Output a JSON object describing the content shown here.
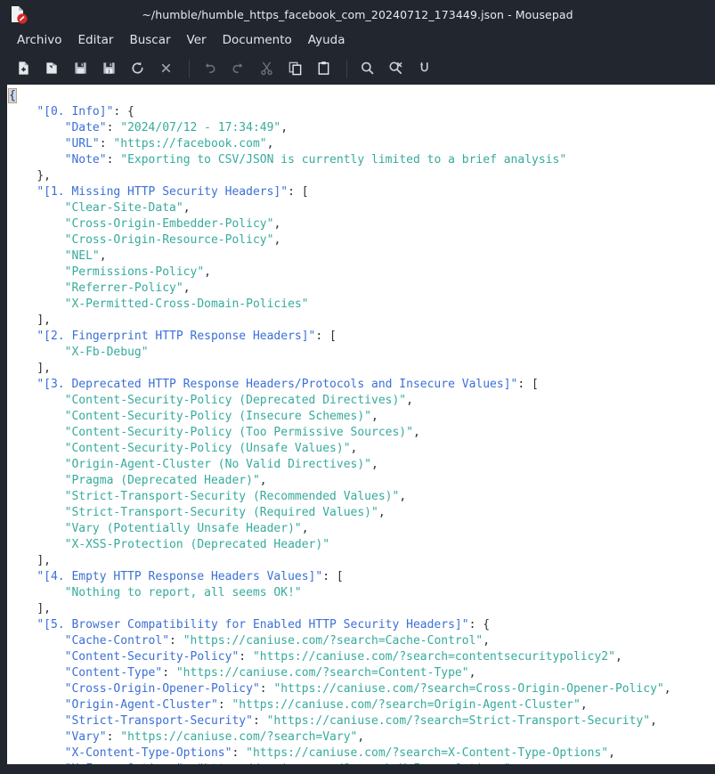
{
  "window": {
    "title": "~/humble/humble_https_facebook_com_20240712_173449.json - Mousepad",
    "icon": "document-modified-icon"
  },
  "menubar": {
    "items": [
      {
        "label": "Archivo"
      },
      {
        "label": "Editar"
      },
      {
        "label": "Buscar"
      },
      {
        "label": "Ver"
      },
      {
        "label": "Documento"
      },
      {
        "label": "Ayuda"
      }
    ]
  },
  "toolbar": {
    "groups": [
      [
        {
          "name": "new-document-icon"
        },
        {
          "name": "open-document-icon"
        },
        {
          "name": "save-icon"
        },
        {
          "name": "save-as-icon"
        },
        {
          "name": "reload-icon"
        },
        {
          "name": "close-document-icon"
        }
      ],
      [
        {
          "name": "undo-icon"
        },
        {
          "name": "redo-icon"
        },
        {
          "name": "cut-icon"
        },
        {
          "name": "copy-icon"
        },
        {
          "name": "paste-icon"
        }
      ],
      [
        {
          "name": "find-icon"
        },
        {
          "name": "find-replace-icon"
        },
        {
          "name": "go-to-line-icon"
        }
      ]
    ]
  },
  "editor": {
    "colors": {
      "key": "#3b6fd6",
      "value": "#36ab9b",
      "punctuation": "#2b3038",
      "background": "#ffffff",
      "chrome": "#22262e"
    },
    "lines": [
      {
        "indent": 0,
        "segs": [
          {
            "t": "{",
            "c": "hl"
          }
        ]
      },
      {
        "indent": 1,
        "segs": [
          {
            "t": "\"[0. Info]\"",
            "c": "k"
          },
          {
            "t": ": {",
            "c": "p"
          }
        ]
      },
      {
        "indent": 2,
        "segs": [
          {
            "t": "\"Date\"",
            "c": "k"
          },
          {
            "t": ": ",
            "c": "p"
          },
          {
            "t": "\"2024/07/12 - 17:34:49\"",
            "c": "v"
          },
          {
            "t": ",",
            "c": "p"
          }
        ]
      },
      {
        "indent": 2,
        "segs": [
          {
            "t": "\"URL\"",
            "c": "k"
          },
          {
            "t": ": ",
            "c": "p"
          },
          {
            "t": "\"https://facebook.com\"",
            "c": "v"
          },
          {
            "t": ",",
            "c": "p"
          }
        ]
      },
      {
        "indent": 2,
        "segs": [
          {
            "t": "\"Note\"",
            "c": "k"
          },
          {
            "t": ": ",
            "c": "p"
          },
          {
            "t": "\"Exporting to CSV/JSON is currently limited to a brief analysis\"",
            "c": "v"
          }
        ]
      },
      {
        "indent": 1,
        "segs": [
          {
            "t": "},",
            "c": "p"
          }
        ]
      },
      {
        "indent": 1,
        "segs": [
          {
            "t": "\"[1. Missing HTTP Security Headers]\"",
            "c": "k"
          },
          {
            "t": ": [",
            "c": "p"
          }
        ]
      },
      {
        "indent": 2,
        "segs": [
          {
            "t": "\"Clear-Site-Data\"",
            "c": "v"
          },
          {
            "t": ",",
            "c": "p"
          }
        ]
      },
      {
        "indent": 2,
        "segs": [
          {
            "t": "\"Cross-Origin-Embedder-Policy\"",
            "c": "v"
          },
          {
            "t": ",",
            "c": "p"
          }
        ]
      },
      {
        "indent": 2,
        "segs": [
          {
            "t": "\"Cross-Origin-Resource-Policy\"",
            "c": "v"
          },
          {
            "t": ",",
            "c": "p"
          }
        ]
      },
      {
        "indent": 2,
        "segs": [
          {
            "t": "\"NEL\"",
            "c": "v"
          },
          {
            "t": ",",
            "c": "p"
          }
        ]
      },
      {
        "indent": 2,
        "segs": [
          {
            "t": "\"Permissions-Policy\"",
            "c": "v"
          },
          {
            "t": ",",
            "c": "p"
          }
        ]
      },
      {
        "indent": 2,
        "segs": [
          {
            "t": "\"Referrer-Policy\"",
            "c": "v"
          },
          {
            "t": ",",
            "c": "p"
          }
        ]
      },
      {
        "indent": 2,
        "segs": [
          {
            "t": "\"X-Permitted-Cross-Domain-Policies\"",
            "c": "v"
          }
        ]
      },
      {
        "indent": 1,
        "segs": [
          {
            "t": "],",
            "c": "p"
          }
        ]
      },
      {
        "indent": 1,
        "segs": [
          {
            "t": "\"[2. Fingerprint HTTP Response Headers]\"",
            "c": "k"
          },
          {
            "t": ": [",
            "c": "p"
          }
        ]
      },
      {
        "indent": 2,
        "segs": [
          {
            "t": "\"X-Fb-Debug\"",
            "c": "v"
          }
        ]
      },
      {
        "indent": 1,
        "segs": [
          {
            "t": "],",
            "c": "p"
          }
        ]
      },
      {
        "indent": 1,
        "segs": [
          {
            "t": "\"[3. Deprecated HTTP Response Headers/Protocols and Insecure Values]\"",
            "c": "k"
          },
          {
            "t": ": [",
            "c": "p"
          }
        ]
      },
      {
        "indent": 2,
        "segs": [
          {
            "t": "\"Content-Security-Policy (Deprecated Directives)\"",
            "c": "v"
          },
          {
            "t": ",",
            "c": "p"
          }
        ]
      },
      {
        "indent": 2,
        "segs": [
          {
            "t": "\"Content-Security-Policy (Insecure Schemes)\"",
            "c": "v"
          },
          {
            "t": ",",
            "c": "p"
          }
        ]
      },
      {
        "indent": 2,
        "segs": [
          {
            "t": "\"Content-Security-Policy (Too Permissive Sources)\"",
            "c": "v"
          },
          {
            "t": ",",
            "c": "p"
          }
        ]
      },
      {
        "indent": 2,
        "segs": [
          {
            "t": "\"Content-Security-Policy (Unsafe Values)\"",
            "c": "v"
          },
          {
            "t": ",",
            "c": "p"
          }
        ]
      },
      {
        "indent": 2,
        "segs": [
          {
            "t": "\"Origin-Agent-Cluster (No Valid Directives)\"",
            "c": "v"
          },
          {
            "t": ",",
            "c": "p"
          }
        ]
      },
      {
        "indent": 2,
        "segs": [
          {
            "t": "\"Pragma (Deprecated Header)\"",
            "c": "v"
          },
          {
            "t": ",",
            "c": "p"
          }
        ]
      },
      {
        "indent": 2,
        "segs": [
          {
            "t": "\"Strict-Transport-Security (Recommended Values)\"",
            "c": "v"
          },
          {
            "t": ",",
            "c": "p"
          }
        ]
      },
      {
        "indent": 2,
        "segs": [
          {
            "t": "\"Strict-Transport-Security (Required Values)\"",
            "c": "v"
          },
          {
            "t": ",",
            "c": "p"
          }
        ]
      },
      {
        "indent": 2,
        "segs": [
          {
            "t": "\"Vary (Potentially Unsafe Header)\"",
            "c": "v"
          },
          {
            "t": ",",
            "c": "p"
          }
        ]
      },
      {
        "indent": 2,
        "segs": [
          {
            "t": "\"X-XSS-Protection (Deprecated Header)\"",
            "c": "v"
          }
        ]
      },
      {
        "indent": 1,
        "segs": [
          {
            "t": "],",
            "c": "p"
          }
        ]
      },
      {
        "indent": 1,
        "segs": [
          {
            "t": "\"[4. Empty HTTP Response Headers Values]\"",
            "c": "k"
          },
          {
            "t": ": [",
            "c": "p"
          }
        ]
      },
      {
        "indent": 2,
        "segs": [
          {
            "t": "\"Nothing to report, all seems OK!\"",
            "c": "v"
          }
        ]
      },
      {
        "indent": 1,
        "segs": [
          {
            "t": "],",
            "c": "p"
          }
        ]
      },
      {
        "indent": 1,
        "segs": [
          {
            "t": "\"[5. Browser Compatibility for Enabled HTTP Security Headers]\"",
            "c": "k"
          },
          {
            "t": ": {",
            "c": "p"
          }
        ]
      },
      {
        "indent": 2,
        "segs": [
          {
            "t": "\"Cache-Control\"",
            "c": "k"
          },
          {
            "t": ": ",
            "c": "p"
          },
          {
            "t": "\"https://caniuse.com/?search=Cache-Control\"",
            "c": "v"
          },
          {
            "t": ",",
            "c": "p"
          }
        ]
      },
      {
        "indent": 2,
        "segs": [
          {
            "t": "\"Content-Security-Policy\"",
            "c": "k"
          },
          {
            "t": ": ",
            "c": "p"
          },
          {
            "t": "\"https://caniuse.com/?search=contentsecuritypolicy2\"",
            "c": "v"
          },
          {
            "t": ",",
            "c": "p"
          }
        ]
      },
      {
        "indent": 2,
        "segs": [
          {
            "t": "\"Content-Type\"",
            "c": "k"
          },
          {
            "t": ": ",
            "c": "p"
          },
          {
            "t": "\"https://caniuse.com/?search=Content-Type\"",
            "c": "v"
          },
          {
            "t": ",",
            "c": "p"
          }
        ]
      },
      {
        "indent": 2,
        "segs": [
          {
            "t": "\"Cross-Origin-Opener-Policy\"",
            "c": "k"
          },
          {
            "t": ": ",
            "c": "p"
          },
          {
            "t": "\"https://caniuse.com/?search=Cross-Origin-Opener-Policy\"",
            "c": "v"
          },
          {
            "t": ",",
            "c": "p"
          }
        ]
      },
      {
        "indent": 2,
        "segs": [
          {
            "t": "\"Origin-Agent-Cluster\"",
            "c": "k"
          },
          {
            "t": ": ",
            "c": "p"
          },
          {
            "t": "\"https://caniuse.com/?search=Origin-Agent-Cluster\"",
            "c": "v"
          },
          {
            "t": ",",
            "c": "p"
          }
        ]
      },
      {
        "indent": 2,
        "segs": [
          {
            "t": "\"Strict-Transport-Security\"",
            "c": "k"
          },
          {
            "t": ": ",
            "c": "p"
          },
          {
            "t": "\"https://caniuse.com/?search=Strict-Transport-Security\"",
            "c": "v"
          },
          {
            "t": ",",
            "c": "p"
          }
        ]
      },
      {
        "indent": 2,
        "segs": [
          {
            "t": "\"Vary\"",
            "c": "k"
          },
          {
            "t": ": ",
            "c": "p"
          },
          {
            "t": "\"https://caniuse.com/?search=Vary\"",
            "c": "v"
          },
          {
            "t": ",",
            "c": "p"
          }
        ]
      },
      {
        "indent": 2,
        "segs": [
          {
            "t": "\"X-Content-Type-Options\"",
            "c": "k"
          },
          {
            "t": ": ",
            "c": "p"
          },
          {
            "t": "\"https://caniuse.com/?search=X-Content-Type-Options\"",
            "c": "v"
          },
          {
            "t": ",",
            "c": "p"
          }
        ]
      },
      {
        "indent": 2,
        "segs": [
          {
            "t": "\"X-Frame-Options\"",
            "c": "k"
          },
          {
            "t": ": ",
            "c": "p"
          },
          {
            "t": "\"https://caniuse.com/?search=X-Frame-Options\"",
            "c": "v"
          }
        ]
      }
    ]
  }
}
